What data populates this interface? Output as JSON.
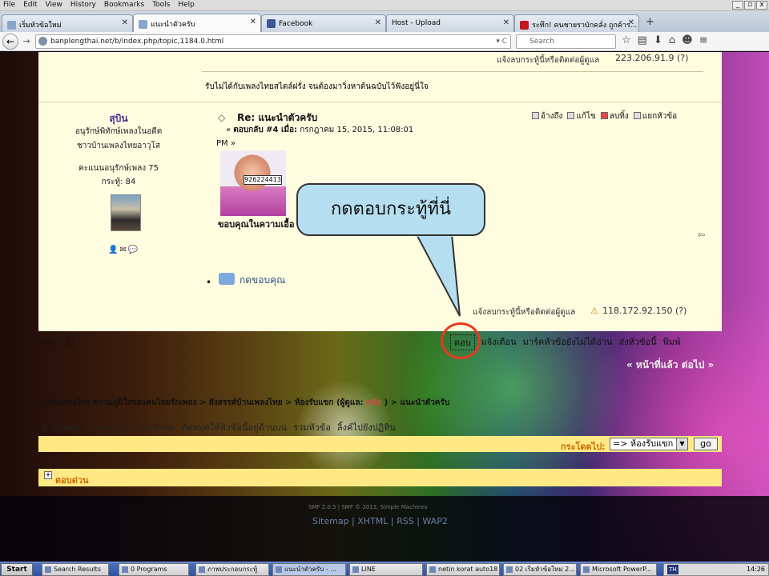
{
  "menubar": {
    "items": [
      "File",
      "Edit",
      "View",
      "History",
      "Bookmarks",
      "Tools",
      "Help"
    ]
  },
  "window": {
    "controls": [
      "_",
      "▫",
      "x"
    ]
  },
  "tabs": [
    {
      "label": "เริ่มหัวข้อใหม่",
      "close": "✕"
    },
    {
      "label": "แนะนำตัวครับ",
      "close": "✕"
    },
    {
      "label": "Facebook",
      "close": "✕"
    },
    {
      "label": "Host - Upload",
      "close": "✕"
    },
    {
      "label": "ระทึก! คนชายราบักคลั่ง ถูกค้าร...",
      "close": "✕"
    }
  ],
  "newtab": "+",
  "nav": {
    "back": "←",
    "forward": "→",
    "url": "banplengthai.net/b/index.php/topic,1184.0.html",
    "search_placeholder": "Search",
    "reload": "▾ C"
  },
  "nav_icons": [
    "☆",
    "▤",
    "⬇",
    "⌂",
    "☻",
    "≡"
  ],
  "post_prev": {
    "report": "แจ้งลบกระทู้นี้หรือติดต่อผู้ดูแล",
    "ip": "223.206.91.9 (?)",
    "quote": "รับไม่ได้กับเพลงไทยสไตล์ฝรั่ง จนต้องมาวิ่งหาต้นฉบับไว้ฟังอยู่นี่ใจ"
  },
  "user": {
    "name": "สุบิน",
    "title1": "อนุรักษ์พิทักษ์เพลงในอดีต",
    "title2": "ชาวบ้านเพลงไทยอาวุโส",
    "score": "คะแนนอนุรักษ์เพลง 75",
    "posts": "กระทู้: 84",
    "icons": "👤✉💬"
  },
  "post": {
    "title": "Re: แนะนำตัวครับ",
    "meta_label": "ตอบกลับ #4 เมื่อ:",
    "meta_date": "กรกฎาคม 15, 2015, 11:08:01",
    "meta_pm": "PM »",
    "image_caption": "926224413",
    "body": "ขอบคุณในความเอื้อ",
    "thank": "กดขอบคุณ",
    "report": "แจ้งลบกระทู้นี้หรือติดต่อผู้ดูแล",
    "ip": "118.172.92.150 (?)",
    "report_icon": "⇦"
  },
  "post_tools": [
    "อ้างถึง",
    "แก้ไข",
    "ลบทิ้ง",
    "แยกหัวข้อ"
  ],
  "callout": {
    "text": "กดตอบกระทู้ที่นี่"
  },
  "pages": "หน้า: [1]",
  "lower_links": [
    "ตอบ",
    "แจ้งเตือน",
    "มาร์คหัวข้อยังไม่ได้อ่าน",
    "ส่งหัวข้อนี้",
    "พิมพ์"
  ],
  "prevnext": "« หน้าที่แล้ว ต่อไป »",
  "breadcrumb": {
    "a": "บ้านเพลงไทย ความภูมิใจของคนไทยรักเพลง",
    "b": "สังสรรค์บ้านเพลงไทย",
    "c": "ห้องรับแขก",
    "mod": "(ผู้ดูแล:",
    "mod_name": "ดนัย",
    "d": "แนะนำตัวครับ",
    "sep": ">"
  },
  "mod_links": [
    "ย้ายข้อความ",
    "ลบหัวข้อ",
    "ล็อกหัวข้อ",
    "ติดหมุดให้หัวข้อนี้อยู่ด้านบน",
    "รวมหัวข้อ",
    "ลิ้งค์ไปยังปฏิทิน"
  ],
  "jump": {
    "label": "กระโดดไป:",
    "selected": "=> ห้องรับแขก",
    "go": "go"
  },
  "quickreply": {
    "label": "ตอบด่วน",
    "plus": "+"
  },
  "footer": {
    "smf": "SMF 2.0.5 | SMF © 2013, Simple Machines",
    "links": "Sitemap | XHTML | RSS | WAP2"
  },
  "taskbar": {
    "start": "Start",
    "items": [
      "Search Results",
      "0 Programs",
      "ภาพประกอบกระทู้",
      "แนะนำตัวครับ - ...",
      "LINE",
      "netin korat auto18",
      "02 เริ่มหัวข้อใหม่ 2...",
      "Microsoft PowerP..."
    ],
    "lang": "TH",
    "clock": "14:26"
  }
}
